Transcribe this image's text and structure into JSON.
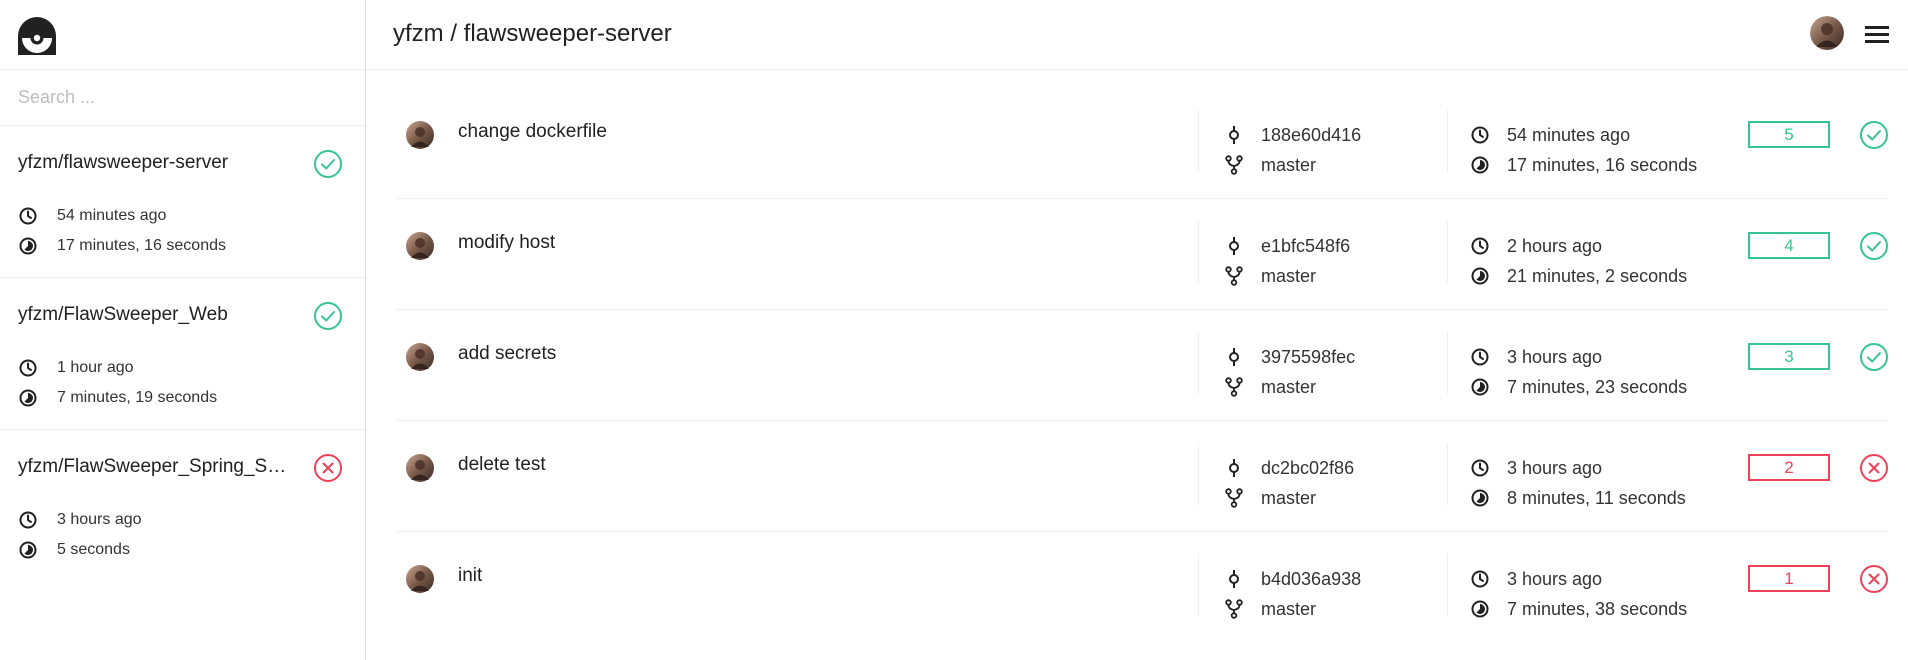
{
  "header": {
    "title": "yfzm / flawsweeper-server"
  },
  "search": {
    "placeholder": "Search ..."
  },
  "colors": {
    "success": "#36c494",
    "failure": "#f0415b"
  },
  "repos": [
    {
      "name": "yfzm/flawsweeper-server",
      "status": "success",
      "time": "54 minutes ago",
      "duration": "17 minutes, 16 seconds"
    },
    {
      "name": "yfzm/FlawSweeper_Web",
      "status": "success",
      "time": "1 hour ago",
      "duration": "7 minutes, 19 seconds"
    },
    {
      "name": "yfzm/FlawSweeper_Spring_Ser...",
      "status": "failure",
      "time": "3 hours ago",
      "duration": "5 seconds"
    }
  ],
  "builds": [
    {
      "message": "change dockerfile",
      "commit": "188e60d416",
      "branch": "master",
      "time": "54 minutes ago",
      "duration": "17 minutes, 16 seconds",
      "number": "5",
      "status": "success"
    },
    {
      "message": "modify host",
      "commit": "e1bfc548f6",
      "branch": "master",
      "time": "2 hours ago",
      "duration": "21 minutes, 2 seconds",
      "number": "4",
      "status": "success"
    },
    {
      "message": "add secrets",
      "commit": "3975598fec",
      "branch": "master",
      "time": "3 hours ago",
      "duration": "7 minutes, 23 seconds",
      "number": "3",
      "status": "success"
    },
    {
      "message": "delete test",
      "commit": "dc2bc02f86",
      "branch": "master",
      "time": "3 hours ago",
      "duration": "8 minutes, 11 seconds",
      "number": "2",
      "status": "failure"
    },
    {
      "message": "init",
      "commit": "b4d036a938",
      "branch": "master",
      "time": "3 hours ago",
      "duration": "7 minutes, 38 seconds",
      "number": "1",
      "status": "failure"
    }
  ]
}
